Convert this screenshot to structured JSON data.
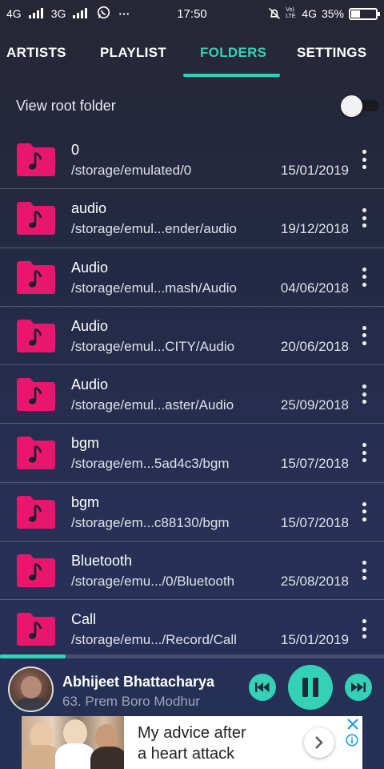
{
  "status_bar": {
    "network1": "4G",
    "network2": "3G",
    "overflow": "···",
    "time": "17:50",
    "volte": "Vo) LTE",
    "network3": "4G",
    "battery_text": "35%",
    "battery_level": 0.35,
    "icons": [
      "signal-icon",
      "whatsapp-icon",
      "alarm-off-icon",
      "battery-icon"
    ]
  },
  "tabs": [
    {
      "label": "ARTISTS",
      "active": false
    },
    {
      "label": "PLAYLIST",
      "active": false
    },
    {
      "label": "FOLDERS",
      "active": true
    },
    {
      "label": "SETTINGS",
      "active": false
    }
  ],
  "root_folder": {
    "label": "View root folder",
    "enabled": false
  },
  "folders": [
    {
      "name": "0",
      "path": "/storage/emulated/0",
      "date": "15/01/2019"
    },
    {
      "name": "audio",
      "path": "/storage/emul...ender/audio",
      "date": "19/12/2018"
    },
    {
      "name": "Audio",
      "path": "/storage/emul...mash/Audio",
      "date": "04/06/2018"
    },
    {
      "name": "Audio",
      "path": "/storage/emul...CITY/Audio",
      "date": "20/06/2018"
    },
    {
      "name": "Audio",
      "path": "/storage/emul...aster/Audio",
      "date": "25/09/2018"
    },
    {
      "name": "bgm",
      "path": "/storage/em...5ad4c3/bgm",
      "date": "15/07/2018"
    },
    {
      "name": "bgm",
      "path": "/storage/em...c88130/bgm",
      "date": "15/07/2018"
    },
    {
      "name": "Bluetooth",
      "path": "/storage/emu.../0/Bluetooth",
      "date": "25/08/2018"
    },
    {
      "name": "Call",
      "path": "/storage/emu.../Record/Call",
      "date": "15/01/2019"
    }
  ],
  "player": {
    "artist": "Abhijeet Bhattacharya",
    "track": "63. Prem Boro Modhur",
    "progress": 0.17,
    "state": "playing"
  },
  "ad": {
    "text_line1": "My advice after",
    "text_line2": "a heart attack"
  },
  "colors": {
    "accent": "#33d1b5",
    "folder": "#e8176d"
  }
}
